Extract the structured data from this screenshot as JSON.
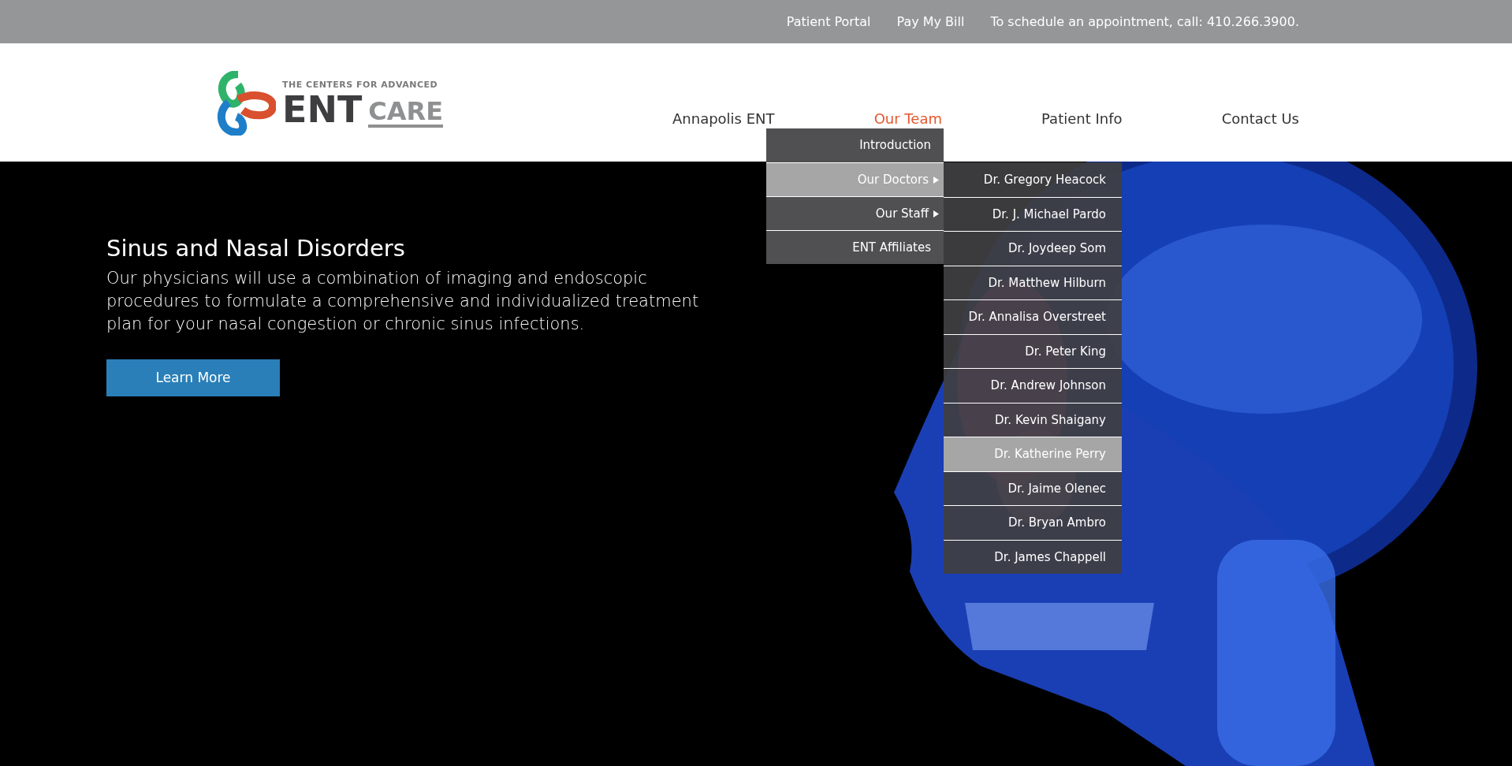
{
  "top_bar": {
    "links": [
      "Patient Portal",
      "Pay My Bill"
    ],
    "contact": "To schedule an appointment, call: 410.266.3900."
  },
  "logo": {
    "tagline": "THE CENTERS FOR ADVANCED",
    "word_1": "ENT",
    "word_2": "CARE"
  },
  "nav": [
    {
      "label": "Annapolis ENT",
      "selected": false
    },
    {
      "label": "Our Team",
      "selected": true
    },
    {
      "label": "Patient Info",
      "selected": false
    },
    {
      "label": "Contact Us",
      "selected": false
    }
  ],
  "dropdown": [
    {
      "label": "Introduction",
      "selected": false,
      "has_submenu": false
    },
    {
      "label": "Our Doctors",
      "selected": true,
      "has_submenu": true
    },
    {
      "label": "Our Staff",
      "selected": false,
      "has_submenu": true
    },
    {
      "label": "ENT Affiliates",
      "selected": false,
      "has_submenu": false
    }
  ],
  "submenu": [
    {
      "label": "Dr. Gregory Heacock",
      "selected": false
    },
    {
      "label": "Dr. J. Michael Pardo",
      "selected": false
    },
    {
      "label": "Dr. Joydeep Som",
      "selected": false
    },
    {
      "label": "Dr. Matthew Hilburn",
      "selected": false
    },
    {
      "label": "Dr. Annalisa Overstreet",
      "selected": false
    },
    {
      "label": "Dr. Peter King",
      "selected": false
    },
    {
      "label": "Dr. Andrew Johnson",
      "selected": false
    },
    {
      "label": "Dr. Kevin Shaigany",
      "selected": false
    },
    {
      "label": "Dr. Katherine Perry",
      "selected": true
    },
    {
      "label": "Dr. Jaime Olenec",
      "selected": false
    },
    {
      "label": "Dr. Bryan Ambro",
      "selected": false
    },
    {
      "label": "Dr. James Chappell",
      "selected": false
    }
  ],
  "hero": {
    "title": "Sinus and Nasal Disorders",
    "text": "Our physicians will use a combination of imaging and endoscopic procedures to formulate a comprehensive and individualized treatment plan for your nasal congestion or chronic sinus infections.",
    "button": "Learn More",
    "kind": "picture"
  }
}
